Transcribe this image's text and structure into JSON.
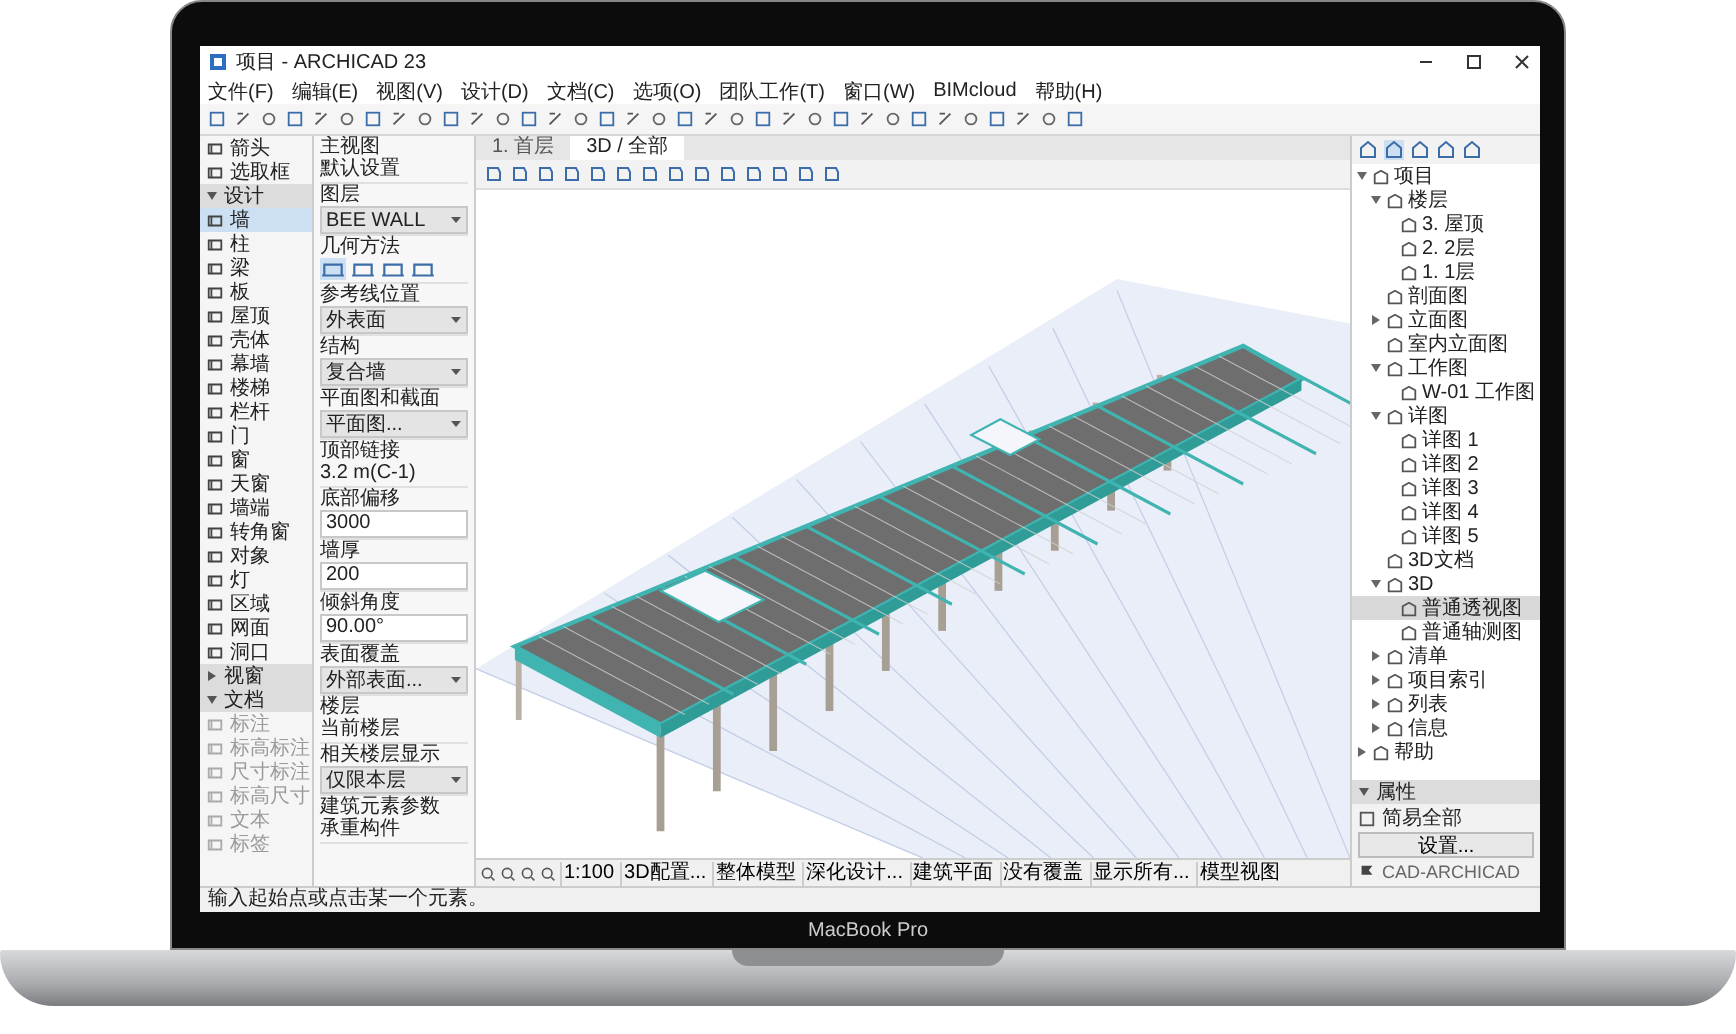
{
  "device_label": "MacBook Pro",
  "window": {
    "title": "项目 - ARCHICAD 23"
  },
  "menu": [
    "文件(F)",
    "编辑(E)",
    "视图(V)",
    "设计(D)",
    "文档(C)",
    "选项(O)",
    "团队工作(T)",
    "窗口(W)",
    "BIMcloud",
    "帮助(H)"
  ],
  "toolbox": [
    {
      "kind": "tool",
      "label": "箭头",
      "selected": false,
      "disabled": false
    },
    {
      "kind": "tool",
      "label": "选取框",
      "selected": false,
      "disabled": false
    },
    {
      "kind": "section",
      "label": "设计",
      "expanded": true
    },
    {
      "kind": "tool",
      "label": "墙",
      "selected": true,
      "disabled": false
    },
    {
      "kind": "tool",
      "label": "柱",
      "selected": false,
      "disabled": false
    },
    {
      "kind": "tool",
      "label": "梁",
      "selected": false,
      "disabled": false
    },
    {
      "kind": "tool",
      "label": "板",
      "selected": false,
      "disabled": false
    },
    {
      "kind": "tool",
      "label": "屋顶",
      "selected": false,
      "disabled": false
    },
    {
      "kind": "tool",
      "label": "壳体",
      "selected": false,
      "disabled": false
    },
    {
      "kind": "tool",
      "label": "幕墙",
      "selected": false,
      "disabled": false
    },
    {
      "kind": "tool",
      "label": "楼梯",
      "selected": false,
      "disabled": false
    },
    {
      "kind": "tool",
      "label": "栏杆",
      "selected": false,
      "disabled": false
    },
    {
      "kind": "tool",
      "label": "门",
      "selected": false,
      "disabled": false
    },
    {
      "kind": "tool",
      "label": "窗",
      "selected": false,
      "disabled": false
    },
    {
      "kind": "tool",
      "label": "天窗",
      "selected": false,
      "disabled": false
    },
    {
      "kind": "tool",
      "label": "墙端",
      "selected": false,
      "disabled": false
    },
    {
      "kind": "tool",
      "label": "转角窗",
      "selected": false,
      "disabled": false
    },
    {
      "kind": "tool",
      "label": "对象",
      "selected": false,
      "disabled": false
    },
    {
      "kind": "tool",
      "label": "灯",
      "selected": false,
      "disabled": false
    },
    {
      "kind": "tool",
      "label": "区域",
      "selected": false,
      "disabled": false
    },
    {
      "kind": "tool",
      "label": "网面",
      "selected": false,
      "disabled": false
    },
    {
      "kind": "tool",
      "label": "洞口",
      "selected": false,
      "disabled": false
    },
    {
      "kind": "section",
      "label": "视窗",
      "expanded": false
    },
    {
      "kind": "section",
      "label": "文档",
      "expanded": true
    },
    {
      "kind": "tool",
      "label": "标注",
      "selected": false,
      "disabled": true
    },
    {
      "kind": "tool",
      "label": "标高标注",
      "selected": false,
      "disabled": true
    },
    {
      "kind": "tool",
      "label": "尺寸标注",
      "selected": false,
      "disabled": true
    },
    {
      "kind": "tool",
      "label": "标高尺寸",
      "selected": false,
      "disabled": true
    },
    {
      "kind": "tool",
      "label": "文本",
      "selected": false,
      "disabled": true
    },
    {
      "kind": "tool",
      "label": "标签",
      "selected": false,
      "disabled": true
    }
  ],
  "properties": [
    {
      "label": "主视图",
      "value": "默认设置",
      "kind": "text"
    },
    {
      "label": "图层",
      "value": "BEE WALL",
      "kind": "select"
    },
    {
      "label": "几何方法",
      "kind": "icons"
    },
    {
      "label": "参考线位置",
      "value": "外表面",
      "kind": "select"
    },
    {
      "label": "结构",
      "value": "复合墙",
      "kind": "select"
    },
    {
      "label": "平面图和截面",
      "value": "平面图...",
      "kind": "select"
    },
    {
      "label": "顶部链接",
      "value": "3.2 m(C-1)",
      "kind": "text"
    },
    {
      "label": "底部偏移",
      "value": "3000",
      "kind": "input"
    },
    {
      "label": "墙厚",
      "value": "200",
      "kind": "input"
    },
    {
      "label": "倾斜角度",
      "value": "90.00°",
      "kind": "input"
    },
    {
      "label": "表面覆盖",
      "value": "外部表面...",
      "kind": "select"
    },
    {
      "label": "楼层",
      "value": "当前楼层",
      "kind": "text"
    },
    {
      "label": "相关楼层显示",
      "value": "仅限本层",
      "kind": "select"
    },
    {
      "label": "建筑元素参数",
      "value": "承重构件",
      "kind": "text"
    }
  ],
  "viewport": {
    "tabs": [
      {
        "label": "1. 首层",
        "selected": false
      },
      {
        "label": "3D / 全部",
        "selected": true
      }
    ],
    "status": [
      "1:100",
      "3D配置...",
      "整体模型",
      "深化设计...",
      "建筑平面",
      "没有覆盖",
      "显示所有...",
      "模型视图"
    ]
  },
  "navigator": {
    "tree": [
      {
        "label": "项目",
        "expanded": true,
        "selected": false,
        "children": [
          {
            "label": "楼层",
            "expanded": true,
            "selected": false,
            "children": [
              {
                "label": "3. 屋顶",
                "selected": false
              },
              {
                "label": "2. 2层",
                "selected": false
              },
              {
                "label": "1. 1层",
                "selected": false
              }
            ]
          },
          {
            "label": "剖面图",
            "selected": false
          },
          {
            "label": "立面图",
            "expanded": false,
            "selected": false
          },
          {
            "label": "室内立面图",
            "selected": false
          },
          {
            "label": "工作图",
            "expanded": true,
            "selected": false,
            "children": [
              {
                "label": "W-01 工作图",
                "selected": false
              }
            ]
          },
          {
            "label": "详图",
            "expanded": true,
            "selected": false,
            "children": [
              {
                "label": "详图 1",
                "selected": false
              },
              {
                "label": "详图 2",
                "selected": false
              },
              {
                "label": "详图 3",
                "selected": false
              },
              {
                "label": "详图 4",
                "selected": false
              },
              {
                "label": "详图 5",
                "selected": false
              }
            ]
          },
          {
            "label": "3D文档",
            "selected": false
          },
          {
            "label": "3D",
            "expanded": true,
            "selected": false,
            "children": [
              {
                "label": "普通透视图",
                "selected": true
              },
              {
                "label": "普通轴测图",
                "selected": false
              }
            ]
          },
          {
            "label": "清单",
            "expanded": false,
            "selected": false
          },
          {
            "label": "项目索引",
            "expanded": false,
            "selected": false
          },
          {
            "label": "列表",
            "expanded": false,
            "selected": false
          },
          {
            "label": "信息",
            "expanded": false,
            "selected": false
          }
        ]
      },
      {
        "label": "帮助",
        "expanded": false,
        "selected": false
      }
    ],
    "properties_header": {
      "label": "属性",
      "expanded": true
    },
    "item": "简易全部",
    "settings_button": "设置...",
    "footer": "CAD-ARCHICAD"
  },
  "prompt": "输入起始点或点击某一个元素。"
}
